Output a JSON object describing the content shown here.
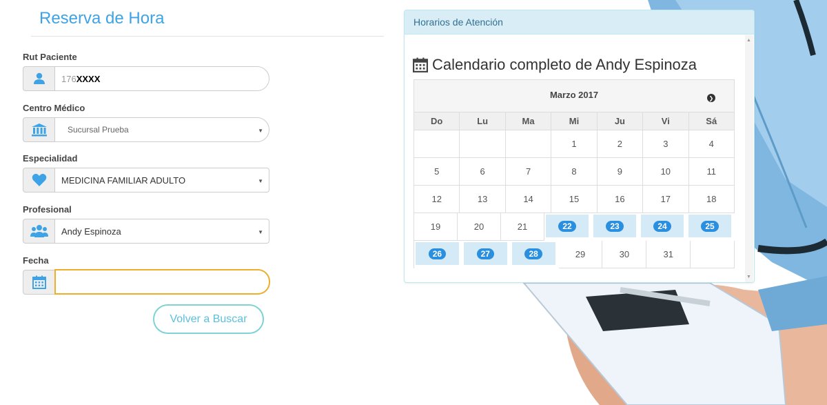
{
  "form": {
    "title": "Reserva de Hora",
    "rut": {
      "label": "Rut Paciente",
      "prefix": "176",
      "masked": "XXXX"
    },
    "centro": {
      "label": "Centro Médico",
      "value": "Sucursal Prueba"
    },
    "especialidad": {
      "label": "Especialidad",
      "value": "MEDICINA FAMILIAR ADULTO"
    },
    "profesional": {
      "label": "Profesional",
      "value": "Andy Espinoza"
    },
    "fecha": {
      "label": "Fecha",
      "value": ""
    },
    "volver_label": "Volver a Buscar"
  },
  "panel": {
    "heading": "Horarios de Atención",
    "calendar_title": "Calendario completo de Andy Espinoza",
    "month": "Marzo 2017",
    "weekdays": [
      "Do",
      "Lu",
      "Ma",
      "Mi",
      "Ju",
      "Vi",
      "Sá"
    ],
    "weeks": [
      [
        {
          "d": ""
        },
        {
          "d": ""
        },
        {
          "d": ""
        },
        {
          "d": "1"
        },
        {
          "d": "2"
        },
        {
          "d": "3"
        },
        {
          "d": "4"
        }
      ],
      [
        {
          "d": "5"
        },
        {
          "d": "6"
        },
        {
          "d": "7"
        },
        {
          "d": "8"
        },
        {
          "d": "9"
        },
        {
          "d": "10"
        },
        {
          "d": "11"
        }
      ],
      [
        {
          "d": "12"
        },
        {
          "d": "13"
        },
        {
          "d": "14"
        },
        {
          "d": "15"
        },
        {
          "d": "16"
        },
        {
          "d": "17"
        },
        {
          "d": "18"
        }
      ],
      [
        {
          "d": "19"
        },
        {
          "d": "20"
        },
        {
          "d": "21"
        },
        {
          "d": "22",
          "a": true
        },
        {
          "d": "23",
          "a": true
        },
        {
          "d": "24",
          "a": true
        },
        {
          "d": "25",
          "a": true
        }
      ],
      [
        {
          "d": "26",
          "a": true
        },
        {
          "d": "27",
          "a": true
        },
        {
          "d": "28",
          "a": true
        },
        {
          "d": "29"
        },
        {
          "d": "30"
        },
        {
          "d": "31"
        },
        {
          "d": ""
        }
      ]
    ]
  },
  "colors": {
    "accent": "#3ea3e6",
    "available_bg": "#d4eaf7",
    "available_badge": "#2b8fe0",
    "focus_border": "#f0ad2a"
  },
  "icons": [
    "user-icon",
    "institution-icon",
    "heart-icon",
    "users-icon",
    "calendar-icon",
    "chevron-right-icon"
  ]
}
